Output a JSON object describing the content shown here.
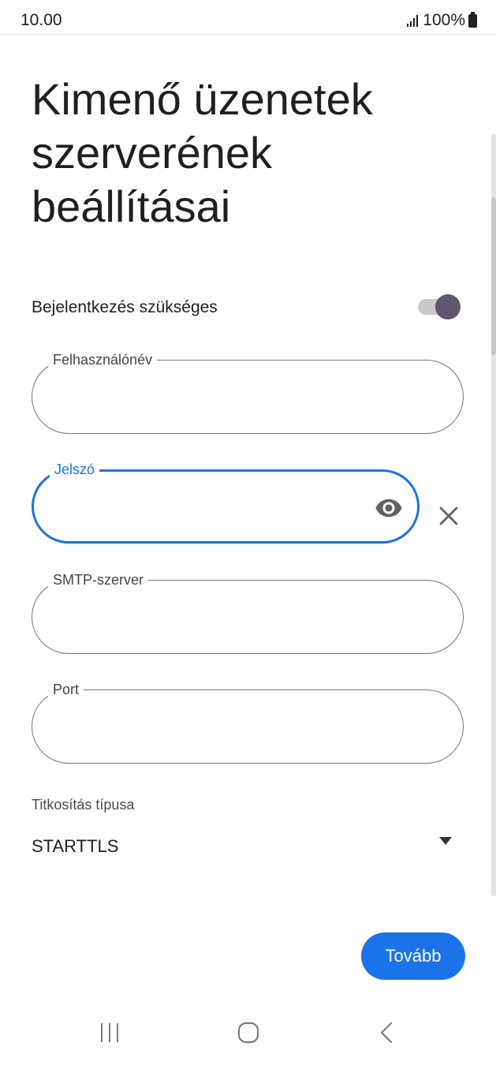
{
  "status_bar": {
    "time": "10.00",
    "battery": "100%"
  },
  "page": {
    "title": "Kimenő üzenetek szerverének beállításai"
  },
  "login_toggle": {
    "label": "Bejelentkezés szükséges",
    "on": true
  },
  "fields": {
    "username": {
      "label": "Felhasználónév",
      "value": ""
    },
    "password": {
      "label": "Jelszó",
      "value": ""
    },
    "smtp": {
      "label": "SMTP-szerver",
      "value": ""
    },
    "port": {
      "label": "Port",
      "value": ""
    }
  },
  "encryption": {
    "label": "Titkosítás típusa",
    "selected": "STARTTLS"
  },
  "actions": {
    "next_label": "Tovább"
  },
  "nav": {
    "recents": "recents-icon",
    "home": "home-icon",
    "back": "back-icon"
  },
  "colors": {
    "accent": "#1a73e8",
    "toggle_knob": "#5f566f"
  }
}
